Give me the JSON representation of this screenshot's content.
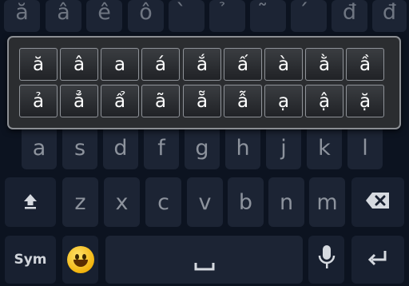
{
  "top_row": [
    "ă",
    "â",
    "ê",
    "ô",
    "̀",
    "̉",
    "̃",
    "́",
    "đ",
    "đ"
  ],
  "popup_row1": [
    "ă",
    "â",
    "a",
    "á",
    "ắ",
    "ấ",
    "à",
    "ằ",
    "ầ"
  ],
  "popup_row2": [
    "ả",
    "ẳ",
    "ẩ",
    "ã",
    "ẵ",
    "ẫ",
    "ạ",
    "ậ",
    "ặ"
  ],
  "home_row": [
    "a",
    "s",
    "d",
    "f",
    "g",
    "h",
    "j",
    "k",
    "l"
  ],
  "bottom_row": [
    "z",
    "x",
    "c",
    "v",
    "b",
    "n",
    "m"
  ],
  "function_row": {
    "sym_label": "Sym"
  },
  "icons": {
    "shift": "shift-arrow-icon",
    "backspace": "backspace-icon",
    "emoji": "smiley-emoji-icon",
    "space": "space-bar-icon",
    "mic": "microphone-icon",
    "enter": "enter-icon"
  },
  "colors": {
    "background": "#0c1320",
    "key": "#1c2434",
    "key_text": "#8d939d",
    "popup_key_text": "#ffffff",
    "popup_border": "#8c8f94"
  }
}
